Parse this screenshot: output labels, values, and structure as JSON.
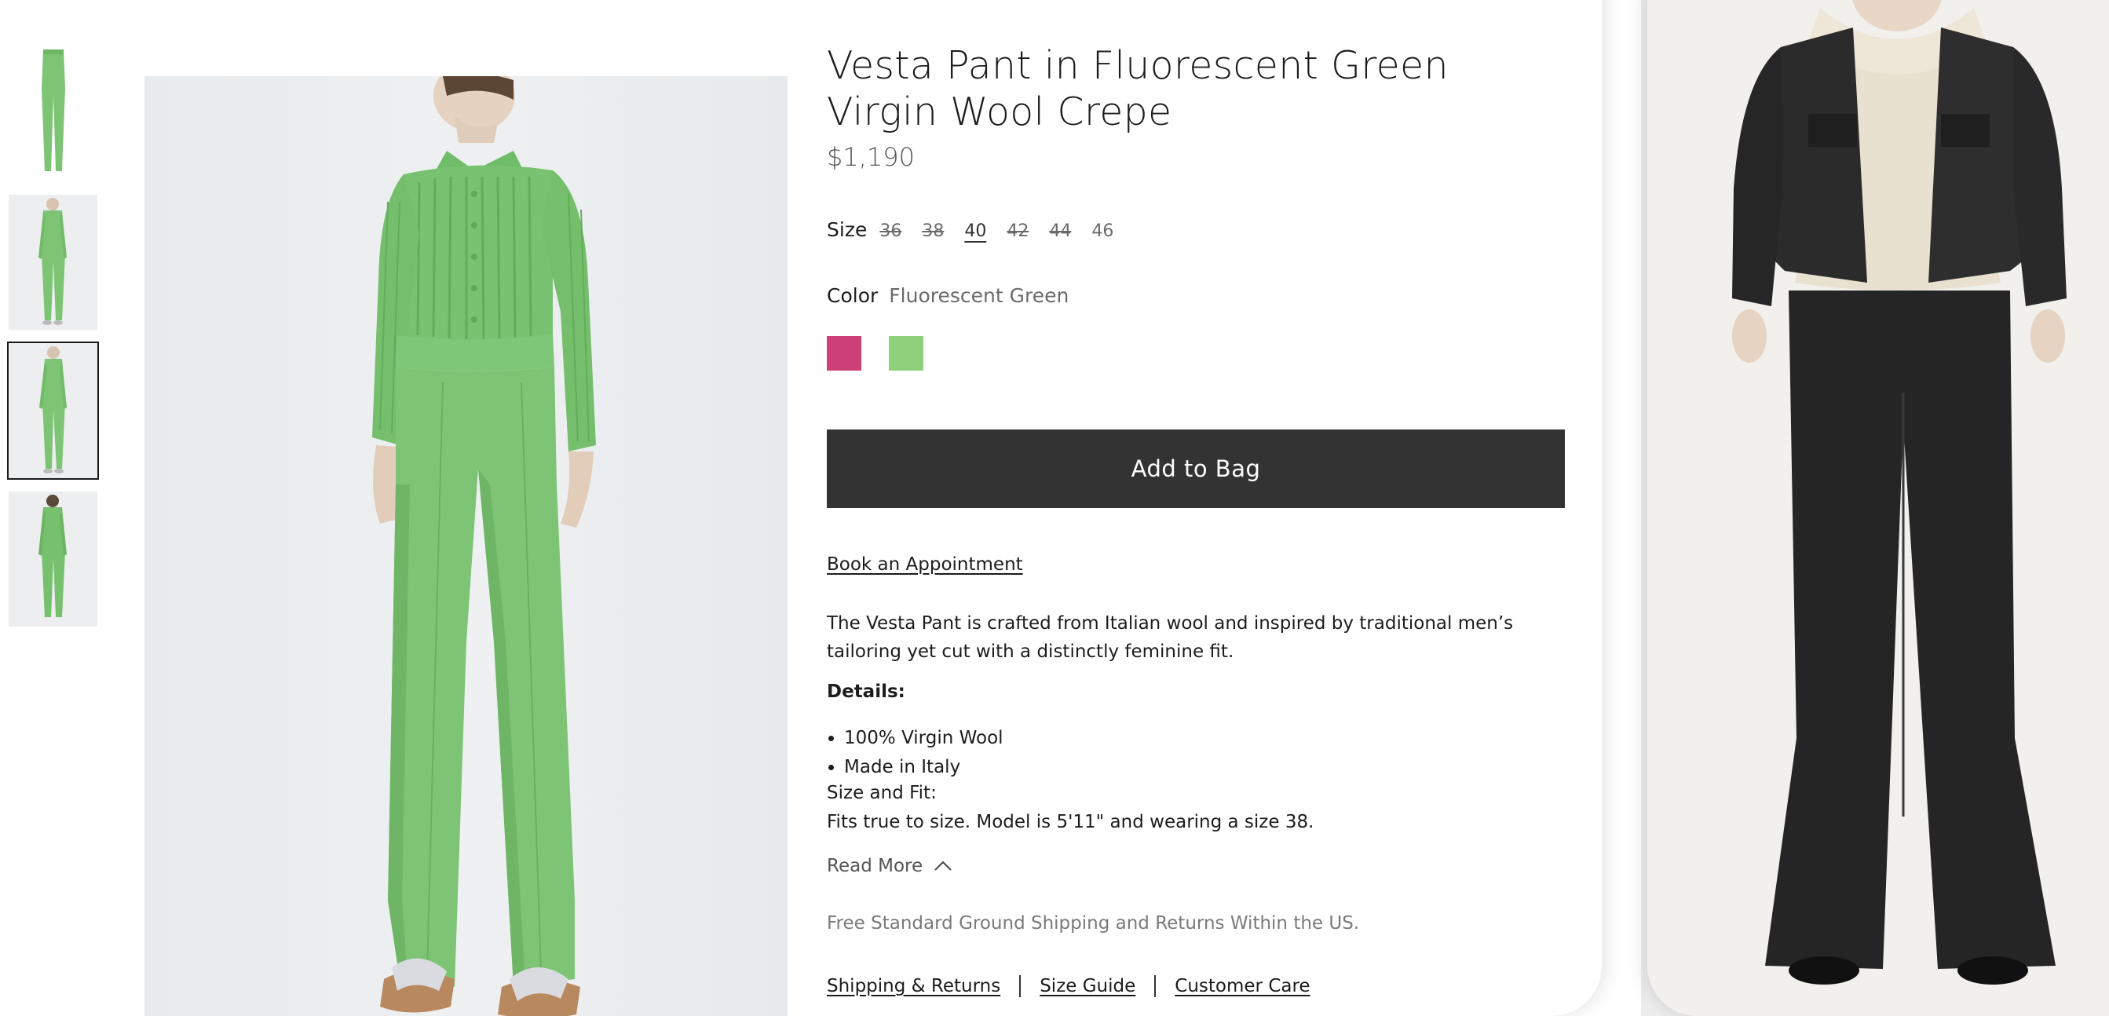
{
  "product": {
    "title": "Vesta Pant in Fluorescent Green Virgin Wool Crepe",
    "price": "$1,190"
  },
  "size": {
    "label": "Size",
    "options": [
      {
        "label": "36",
        "available": false,
        "selected": false
      },
      {
        "label": "38",
        "available": false,
        "selected": false
      },
      {
        "label": "40",
        "available": true,
        "selected": true
      },
      {
        "label": "42",
        "available": false,
        "selected": false
      },
      {
        "label": "44",
        "available": false,
        "selected": false
      },
      {
        "label": "46",
        "available": true,
        "selected": false
      }
    ]
  },
  "color": {
    "label": "Color",
    "value": "Fluorescent Green",
    "swatches": [
      {
        "name": "pink",
        "hex": "#cc3f77"
      },
      {
        "name": "green",
        "hex": "#8ed07c"
      }
    ]
  },
  "actions": {
    "add_to_bag": "Add to Bag",
    "book_appointment": "Book an Appointment"
  },
  "description": {
    "text": "The Vesta Pant is crafted from Italian wool and inspired by traditional men’s tailoring yet cut with a distinctly feminine fit.",
    "details_heading": "Details:",
    "details": [
      "100% Virgin Wool",
      "Made in Italy"
    ],
    "size_fit_label": "Size and Fit:",
    "size_fit_text": "Fits true to size. Model is 5'11\" and wearing a size 38.",
    "read_more": "Read More"
  },
  "shipping_note": "Free Standard Ground Shipping and Returns Within the US.",
  "footer_links": [
    "Shipping & Returns",
    "Size Guide",
    "Customer Care"
  ],
  "gallery": {
    "thumbnail_count": 4,
    "selected_index": 2
  },
  "colors": {
    "button_bg": "#333333",
    "garment_green": "#7dc575",
    "background": "#ffffff"
  },
  "icons": {
    "read_more": "chevron-up-icon"
  }
}
